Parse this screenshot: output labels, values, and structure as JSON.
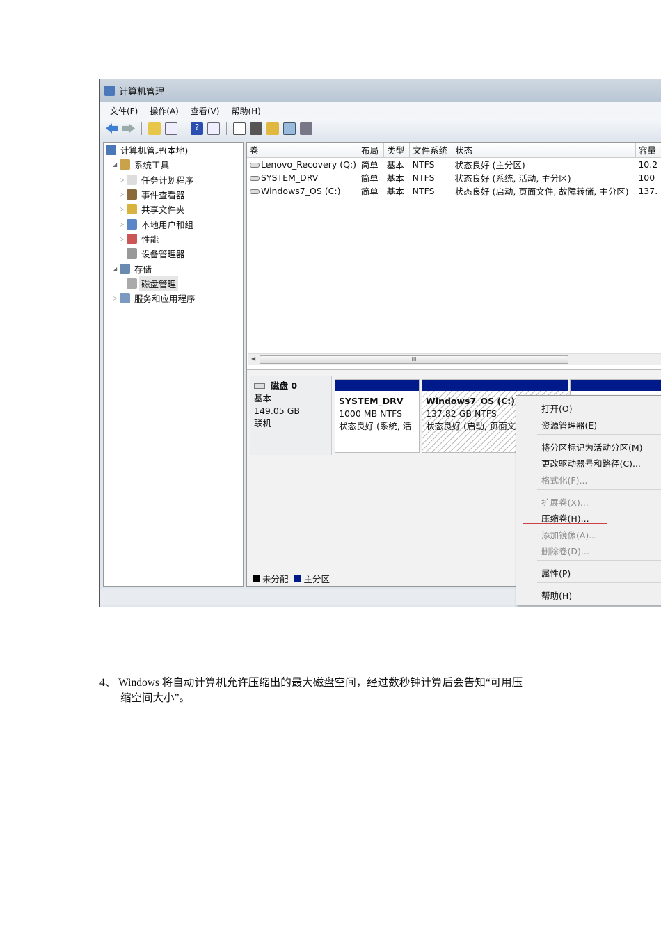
{
  "window": {
    "title": "计算机管理",
    "menu": [
      "文件(F)",
      "操作(A)",
      "查看(V)",
      "帮助(H)"
    ]
  },
  "tree": [
    {
      "label": "计算机管理(本地)",
      "level": 0,
      "icon": "computer-icon",
      "expander": ""
    },
    {
      "label": "系统工具",
      "level": 1,
      "icon": "tools-icon",
      "expander": "◢"
    },
    {
      "label": "任务计划程序",
      "level": 2,
      "icon": "clock-icon",
      "expander": "▷"
    },
    {
      "label": "事件查看器",
      "level": 2,
      "icon": "event-viewer-icon",
      "expander": "▷"
    },
    {
      "label": "共享文件夹",
      "level": 2,
      "icon": "shared-folder-icon",
      "expander": "▷"
    },
    {
      "label": "本地用户和组",
      "level": 2,
      "icon": "users-icon",
      "expander": "▷"
    },
    {
      "label": "性能",
      "level": 2,
      "icon": "performance-icon",
      "expander": "▷"
    },
    {
      "label": "设备管理器",
      "level": 2,
      "icon": "device-manager-icon",
      "expander": ""
    },
    {
      "label": "存储",
      "level": 1,
      "icon": "storage-icon",
      "expander": "◢"
    },
    {
      "label": "磁盘管理",
      "level": 2,
      "icon": "disk-management-icon",
      "expander": "",
      "selected": true
    },
    {
      "label": "服务和应用程序",
      "level": 1,
      "icon": "services-icon",
      "expander": "▷"
    }
  ],
  "volumes": {
    "headers": [
      "卷",
      "布局",
      "类型",
      "文件系统",
      "状态",
      "容量"
    ],
    "rows": [
      [
        "Lenovo_Recovery (Q:)",
        "简单",
        "基本",
        "NTFS",
        "状态良好 (主分区)",
        "10.2"
      ],
      [
        "SYSTEM_DRV",
        "简单",
        "基本",
        "NTFS",
        "状态良好 (系统, 活动, 主分区)",
        "100"
      ],
      [
        "Windows7_OS (C:)",
        "简单",
        "基本",
        "NTFS",
        "状态良好 (启动, 页面文件, 故障转储, 主分区)",
        "137."
      ]
    ],
    "scroll_grip": "III"
  },
  "disk": {
    "name": "磁盘 0",
    "type": "基本",
    "size": "149.05 GB",
    "status": "联机",
    "partitions": [
      {
        "name": "SYSTEM_DRV",
        "size": "1000 MB NTFS",
        "status": "状态良好 (系统, 活"
      },
      {
        "name": "Windows7_OS  (C:)",
        "size": "137.82 GB NTFS",
        "status": "状态良好 (启动, 页面文"
      }
    ],
    "legend": [
      {
        "label": "未分配",
        "color": "#000000"
      },
      {
        "label": "主分区",
        "color": "#001a8c"
      }
    ]
  },
  "context_menu": [
    {
      "label": "打开(O)",
      "enabled": true
    },
    {
      "label": "资源管理器(E)",
      "enabled": true
    },
    {
      "label": "将分区标记为活动分区(M)",
      "enabled": true
    },
    {
      "label": "更改驱动器号和路径(C)...",
      "enabled": true
    },
    {
      "label": "格式化(F)...",
      "enabled": false
    },
    {
      "label": "扩展卷(X)...",
      "enabled": false
    },
    {
      "label": "压缩卷(H)...",
      "enabled": true,
      "highlighted": true
    },
    {
      "label": "添加镜像(A)...",
      "enabled": false
    },
    {
      "label": "删除卷(D)...",
      "enabled": false
    },
    {
      "label": "属性(P)",
      "enabled": true
    },
    {
      "label": "帮助(H)",
      "enabled": true
    }
  ],
  "paragraph": {
    "line1": "4、 Windows 将自动计算机允许压缩出的最大磁盘空间，经过数秒钟计算后会告知“可用压",
    "line2": "缩空间大小”。"
  },
  "colors": {
    "partition_bar": "#001a8c",
    "highlight_box": "#d04040"
  }
}
